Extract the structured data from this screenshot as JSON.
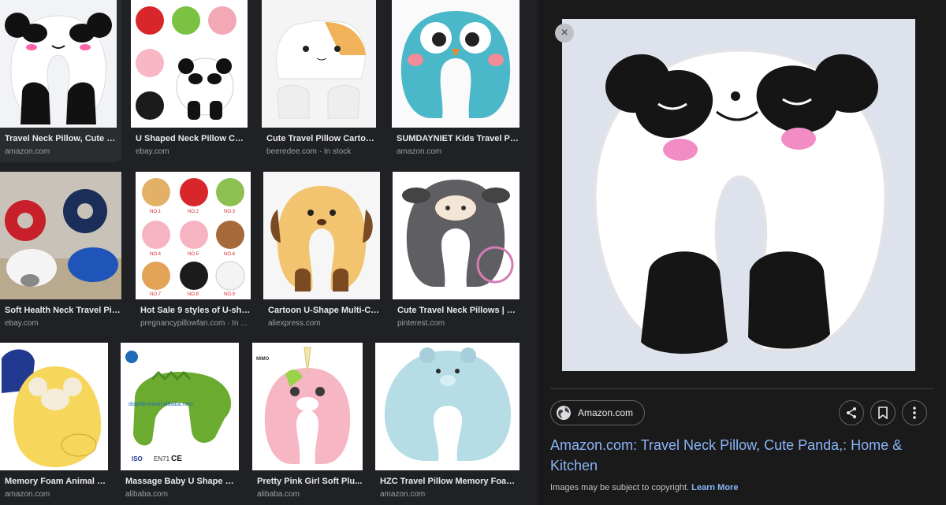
{
  "results": [
    {
      "title": "Travel Neck Pillow, Cute P...",
      "source": "amazon.com",
      "icon": "panda-pillow"
    },
    {
      "title": "U Shaped Neck Pillow Cut...",
      "source": "ebay.com",
      "icon": "animal-pillows-assortment"
    },
    {
      "title": "Cute Travel Pillow Cartoon...",
      "source": "beeredee.com · In stock",
      "icon": "cat-hood-pillow"
    },
    {
      "title": "SUMDAYNIET Kids Travel Pill...",
      "source": "amazon.com",
      "icon": "owl-pillow"
    },
    {
      "title": "Soft Health Neck Travel Pill...",
      "source": "ebay.com",
      "icon": "assorted-pillows"
    },
    {
      "title": "Hot Sale 9 styles of U-sha...",
      "source": "pregnancypillowfan.com · In ...",
      "icon": "nine-styles-pillows"
    },
    {
      "title": "Cartoon U-Shape Multi-Co...",
      "source": "aliexpress.com",
      "icon": "dog-pillow"
    },
    {
      "title": "Cute Travel Neck Pillows | Tv...",
      "source": "pinterest.com",
      "icon": "cow-pillow"
    },
    {
      "title": "Memory Foam Animal T...",
      "source": "amazon.com",
      "icon": "tiger-pillow"
    },
    {
      "title": "Massage Baby U Shape Ne...",
      "source": "alibaba.com",
      "icon": "crocodile-pillow"
    },
    {
      "title": "Pretty Pink Girl Soft Plu...",
      "source": "alibaba.com",
      "icon": "unicorn-pillow"
    },
    {
      "title": "HZC Travel Pillow Memory Foam ...",
      "source": "amazon.com",
      "icon": "bear-pillow"
    }
  ],
  "panel": {
    "site": "Amazon.com",
    "page_title": "Amazon.com: Travel Neck Pillow, Cute Panda,: Home & Kitchen",
    "copyright": "Images may be subject to copyright.",
    "learn_more": "Learn More",
    "close_icon": "×"
  },
  "thumb_marks": {
    "r2c2_labels": [
      "NO.1",
      "NO.2",
      "NO.3",
      "NO.4",
      "NO.5",
      "NO.6",
      "NO.7",
      "NO.8",
      "NO.9"
    ],
    "r3c2_watermark": "dolphin-travel.alibaba.com",
    "r3c2_badges": [
      "ISO",
      "EN71",
      "CE"
    ],
    "r3c3_badge": "MIMO"
  },
  "colors": {
    "background": "#202124",
    "panel": "#1a1a1b",
    "link": "#8ab4f8",
    "muted": "#9aa0a6"
  }
}
